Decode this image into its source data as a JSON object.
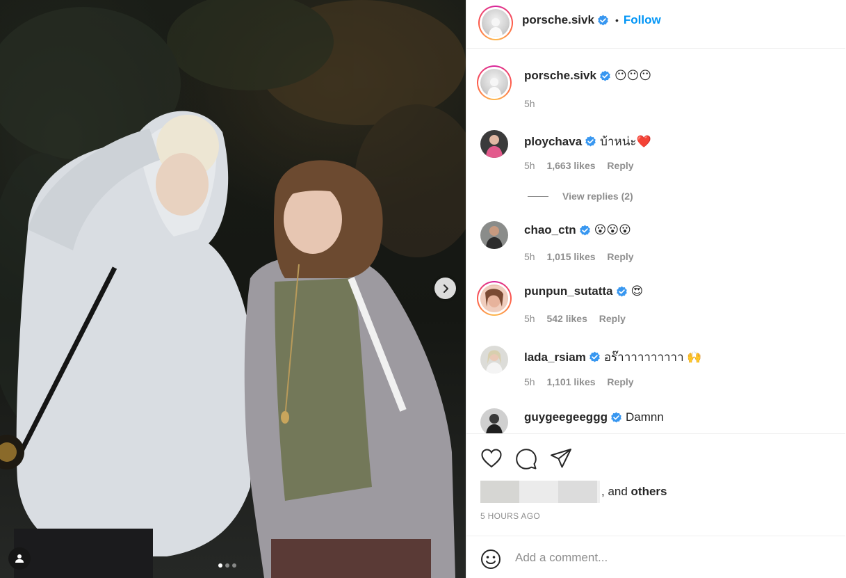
{
  "post": {
    "author": "porsche.sivk",
    "follow_label": "Follow",
    "separator": "•",
    "caption": "😶😶😶",
    "caption_time": "5h",
    "photo_index": 1,
    "photo_count": 3
  },
  "comments": [
    {
      "user": "ploychava",
      "text": "บ้าหน่ะ❤️",
      "time": "5h",
      "likes": "1,663 likes",
      "reply": "Reply",
      "view_replies": "View replies (2)"
    },
    {
      "user": "chao_ctn",
      "text": "😮😮😮",
      "time": "5h",
      "likes": "1,015 likes",
      "reply": "Reply"
    },
    {
      "user": "punpun_sutatta",
      "text": "😍",
      "time": "5h",
      "likes": "542 likes",
      "reply": "Reply"
    },
    {
      "user": "lada_rsiam",
      "text": "อร๊าาาาาาาาาา 🙌",
      "time": "5h",
      "likes": "1,101 likes",
      "reply": "Reply"
    },
    {
      "user": "guygeegeeggg",
      "text": "Damnn"
    }
  ],
  "engagement": {
    "liked_and": ", and",
    "others": "others",
    "timestamp": "5 HOURS AGO"
  },
  "add_comment": {
    "placeholder": "Add a comment..."
  },
  "icons": {
    "verified": "verified-badge-icon",
    "like": "heart-icon",
    "comment": "comment-bubble-icon",
    "share": "paper-plane-icon",
    "emoji": "smiley-icon",
    "next": "chevron-right-icon",
    "tag": "user-tag-icon"
  },
  "colors": {
    "link_blue": "#0095f6",
    "verified_blue": "#3897f0",
    "muted_text": "#8e8e8e",
    "border": "#efefef"
  }
}
